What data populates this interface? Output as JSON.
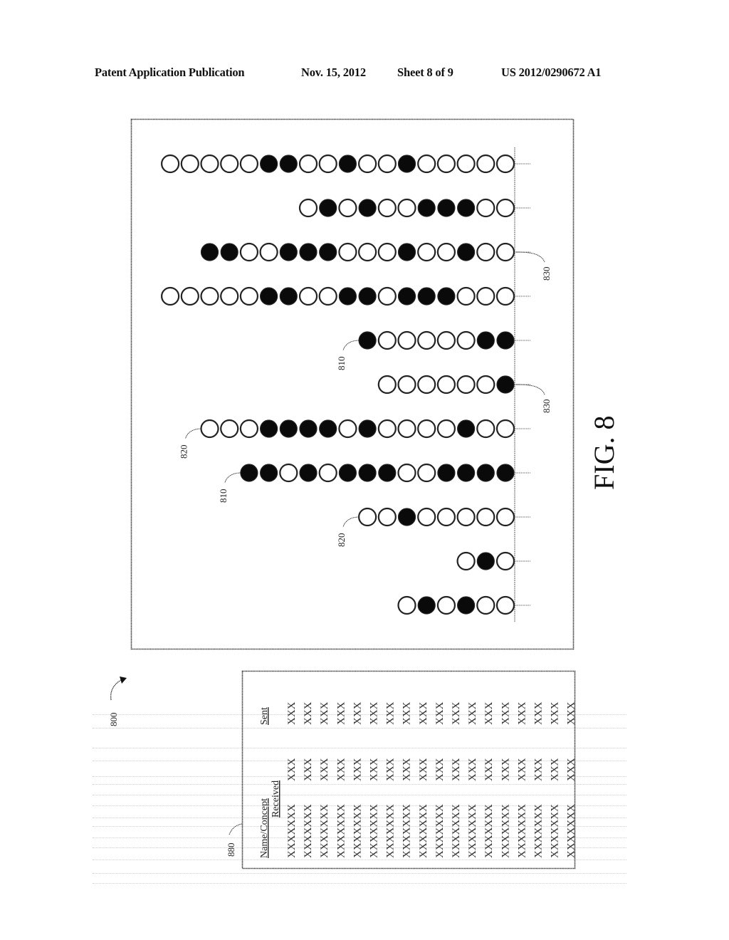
{
  "header": {
    "publication": "Patent Application Publication",
    "date": "Nov. 15, 2012",
    "sheet": "Sheet 8 of 9",
    "number": "US 2012/0290672 A1"
  },
  "figure": {
    "title": "FIG. 8",
    "ref_main": "800",
    "ref_table": "880",
    "legend": {
      "filled": "filled circle",
      "open": "open circle"
    },
    "rows": [
      {
        "pattern": "OOOOO**OO*OO*OOOOO",
        "label": ""
      },
      {
        "pattern": "O*O*OO***OO",
        "label": ""
      },
      {
        "pattern": "**OO***OOO*OO*OO",
        "label": "830"
      },
      {
        "pattern": "OOOOO**OO**O***OOO",
        "label": ""
      },
      {
        "pattern": "*OOOOO**",
        "label": "810"
      },
      {
        "pattern": "OOOOOO*",
        "label": "830"
      },
      {
        "pattern": "OOO****O*OOOO*OO",
        "label": "820"
      },
      {
        "pattern": "**O*O***OO****",
        "label": "810"
      },
      {
        "pattern": "OO*OOOOO",
        "label": "820"
      },
      {
        "pattern": "O*O",
        "label": ""
      },
      {
        "pattern": "O*O*OO",
        "label": ""
      }
    ]
  },
  "table": {
    "headers": {
      "name": "Name/Concept",
      "received": "Received",
      "sent": "Sent"
    },
    "rows": [
      {
        "name": "XXXXXXX",
        "received": "XXX",
        "sent": "XXX"
      },
      {
        "name": "XXXXXXX",
        "received": "XXX",
        "sent": "XXX"
      },
      {
        "name": "XXXXXXX",
        "received": "XXX",
        "sent": "XXX"
      },
      {
        "name": "XXXXXXX",
        "received": "XXX",
        "sent": "XXX"
      },
      {
        "name": "XXXXXXX",
        "received": "XXX",
        "sent": "XXX"
      },
      {
        "name": "XXXXXXX",
        "received": "XXX",
        "sent": "XXX"
      },
      {
        "name": "XXXXXXX",
        "received": "XXX",
        "sent": "XXX"
      },
      {
        "name": "XXXXXXX",
        "received": "XXX",
        "sent": "XXX"
      },
      {
        "name": "XXXXXXX",
        "received": "XXX",
        "sent": "XXX"
      },
      {
        "name": "XXXXXXX",
        "received": "XXX",
        "sent": "XXX"
      },
      {
        "name": "XXXXXXX",
        "received": "XXX",
        "sent": "XXX"
      },
      {
        "name": "XXXXXXX",
        "received": "XXX",
        "sent": "XXX"
      },
      {
        "name": "XXXXXXX",
        "received": "XXX",
        "sent": "XXX"
      },
      {
        "name": "XXXXXXX",
        "received": "XXX",
        "sent": "XXX"
      },
      {
        "name": "XXXXXXX",
        "received": "XXX",
        "sent": "XXX"
      },
      {
        "name": "XXXXXXX",
        "received": "XXX",
        "sent": "XXX"
      },
      {
        "name": "XXXXXXX",
        "received": "XXX",
        "sent": "XXX"
      },
      {
        "name": "XXXXXXX",
        "received": "XXX",
        "sent": "XXX"
      }
    ]
  }
}
